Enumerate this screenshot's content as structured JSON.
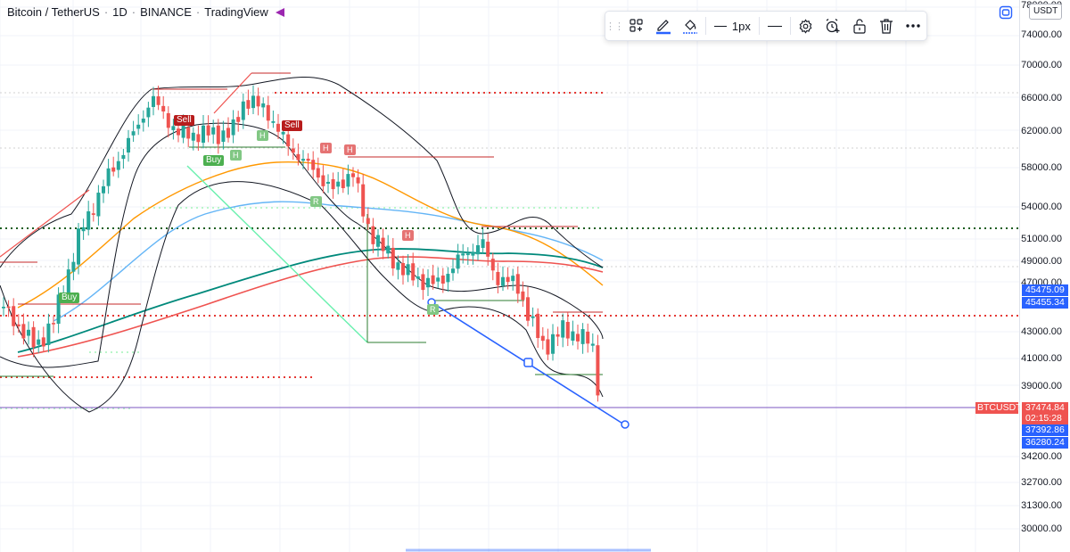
{
  "legend": {
    "symbol": "Bitcoin / TetherUS",
    "interval": "1D",
    "exchange": "BINANCE",
    "source": "TradingView"
  },
  "toolbar": {
    "line_width_label": "1px",
    "icons": [
      "drag-handle-icon",
      "templates-icon",
      "pencil-icon",
      "fill-bucket-icon",
      "line-width-icon",
      "line-style-icon",
      "settings-icon",
      "alert-add-icon",
      "unlock-icon",
      "trash-icon",
      "more-icon"
    ]
  },
  "price_axis": {
    "currency_button": "USDT",
    "labels": [
      "78000.00",
      "74000.00",
      "70000.00",
      "66000.00",
      "62000.00",
      "58000.00",
      "54000.00",
      "51000.00",
      "49000.00",
      "47000.00",
      "43000.00",
      "41000.00",
      "39000.00",
      "34200.00",
      "32700.00",
      "31300.00",
      "30000.00"
    ]
  },
  "price_tags": [
    {
      "text": "45475.09",
      "color": "#2962ff"
    },
    {
      "text": "45455.34",
      "color": "#2962ff"
    },
    {
      "text": "37474.84",
      "color": "#ef5350"
    },
    {
      "text": "02:15:28",
      "color": "#ef5350"
    },
    {
      "text": "37392.86",
      "color": "#2962ff"
    },
    {
      "text": "36280.24",
      "color": "#2962ff"
    }
  ],
  "symbol_tag": {
    "text": "BTCUSDT",
    "color": "#ef5350"
  },
  "signals": {
    "buy": "Buy",
    "sell": "Sell",
    "h": "H",
    "r": "R"
  },
  "colors": {
    "up": "#26a69a",
    "down": "#ef5350",
    "accent": "#2962ff",
    "buy_chip": "#4caf50",
    "sell_chip": "#b71c1c"
  }
}
